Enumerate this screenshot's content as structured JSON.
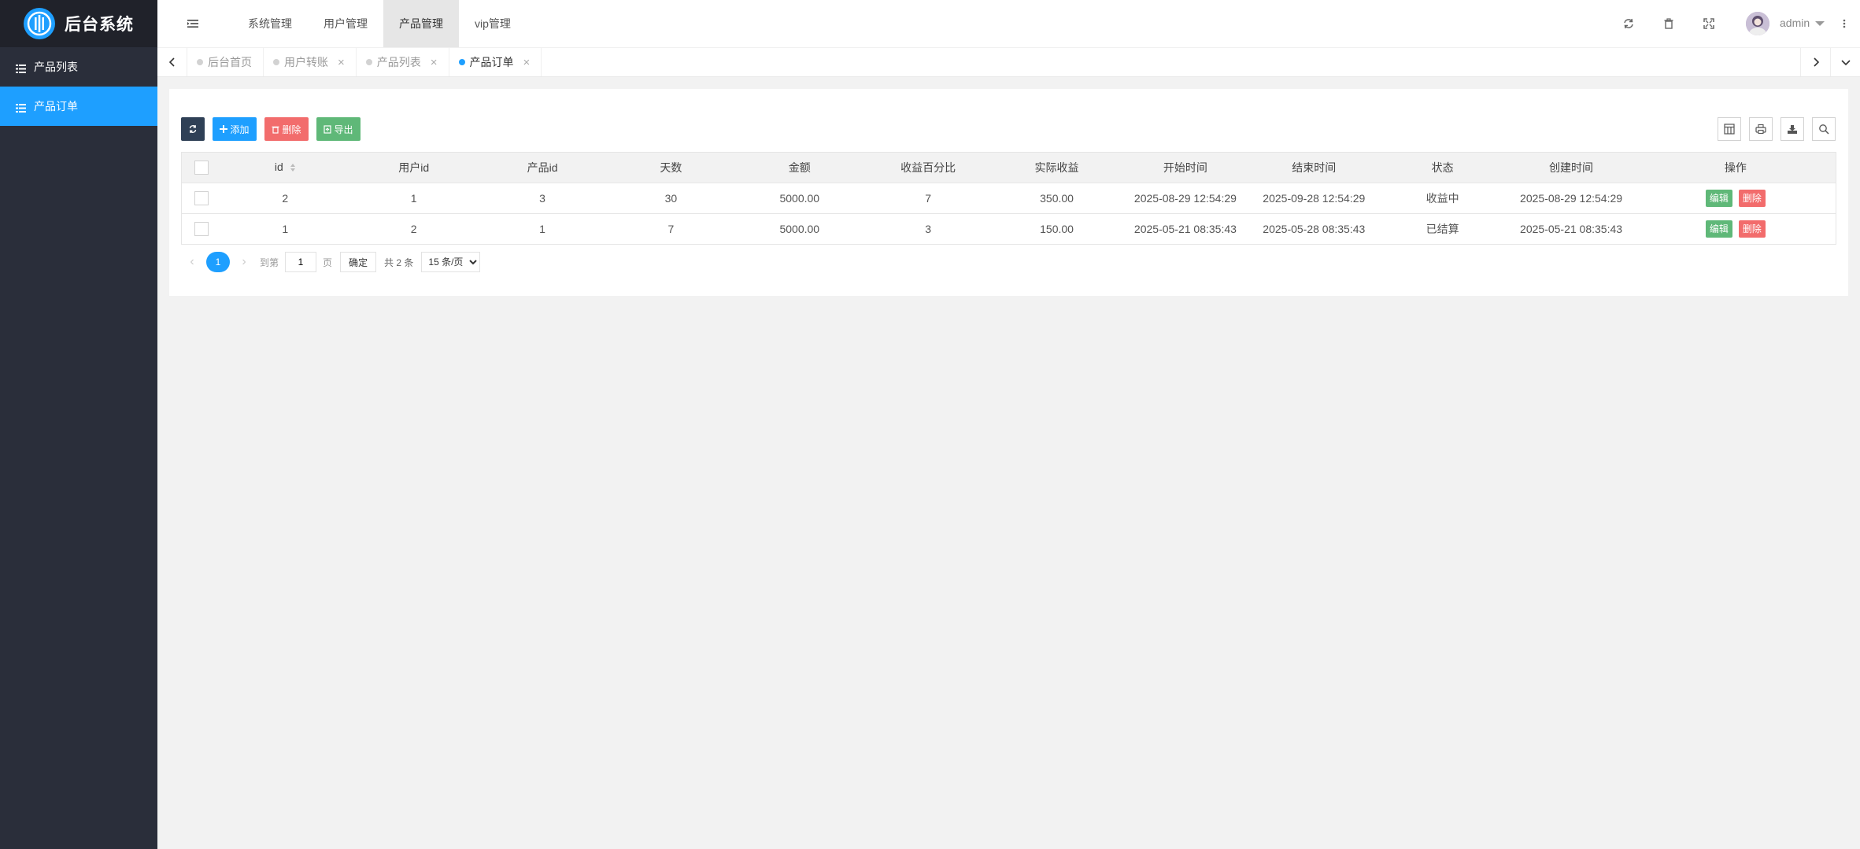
{
  "app": {
    "title": "后台系统"
  },
  "sidebar": {
    "items": [
      {
        "label": "产品列表",
        "active": false
      },
      {
        "label": "产品订单",
        "active": true
      }
    ]
  },
  "header": {
    "nav": [
      {
        "label": "系统管理"
      },
      {
        "label": "用户管理"
      },
      {
        "label": "产品管理",
        "active": true
      },
      {
        "label": "vip管理"
      }
    ],
    "user": {
      "name": "admin"
    }
  },
  "tabs": [
    {
      "label": "后台首页",
      "closable": false
    },
    {
      "label": "用户转账",
      "closable": true
    },
    {
      "label": "产品列表",
      "closable": true
    },
    {
      "label": "产品订单",
      "closable": true,
      "active": true
    }
  ],
  "toolbar": {
    "add_label": "添加",
    "delete_label": "删除",
    "export_label": "导出"
  },
  "table": {
    "columns": [
      "id",
      "用户id",
      "产品id",
      "天数",
      "金额",
      "收益百分比",
      "实际收益",
      "开始时间",
      "结束时间",
      "状态",
      "创建时间",
      "操作"
    ],
    "rows": [
      {
        "id": "2",
        "user_id": "1",
        "product_id": "3",
        "days": "30",
        "amount": "5000.00",
        "rate": "7",
        "income": "350.00",
        "start": "2025-08-29 12:54:29",
        "end": "2025-09-28 12:54:29",
        "status": "收益中",
        "created": "2025-08-29 12:54:29"
      },
      {
        "id": "1",
        "user_id": "2",
        "product_id": "1",
        "days": "7",
        "amount": "5000.00",
        "rate": "3",
        "income": "150.00",
        "start": "2025-05-21 08:35:43",
        "end": "2025-05-28 08:35:43",
        "status": "已结算",
        "created": "2025-05-21 08:35:43"
      }
    ],
    "edit_label": "编辑",
    "delete_label": "删除"
  },
  "pagination": {
    "current": "1",
    "goto_label": "到第",
    "page_value": "1",
    "page_unit": "页",
    "confirm_label": "确定",
    "total_label": "共 2 条",
    "page_size": "15 条/页"
  },
  "colors": {
    "accent": "#1e9fff",
    "sidebar_bg": "#2a2e3a",
    "logo_bg": "#20222a",
    "success": "#5fb878",
    "danger": "#ff5722",
    "dark_btn": "#2f4056"
  }
}
